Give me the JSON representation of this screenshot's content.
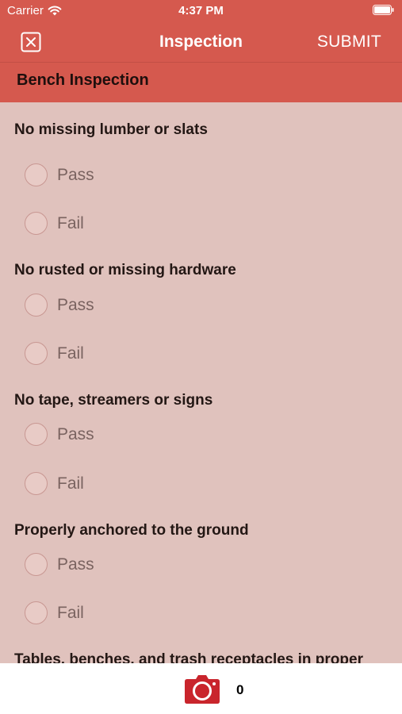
{
  "status_bar": {
    "carrier": "Carrier",
    "time": "4:37 PM",
    "wifi_icon": "wifi-icon",
    "battery_icon": "battery-icon"
  },
  "nav": {
    "close_icon": "close-icon",
    "title": "Inspection",
    "submit_label": "SUBMIT"
  },
  "section_title": "Bench Inspection",
  "questions": [
    {
      "label": "No missing lumber or slats",
      "options": [
        "Pass",
        "Fail"
      ]
    },
    {
      "label": "No rusted or missing hardware",
      "options": [
        "Pass",
        "Fail"
      ]
    },
    {
      "label": "No tape, streamers or signs",
      "options": [
        "Pass",
        "Fail"
      ]
    },
    {
      "label": "Properly anchored to the ground",
      "options": [
        "Pass",
        "Fail"
      ]
    },
    {
      "label": "Tables, benches, and trash receptacles in proper",
      "options": []
    }
  ],
  "bottom_bar": {
    "camera_icon": "camera-icon",
    "photo_count": "0"
  },
  "colors": {
    "header": "#d5594e",
    "background": "#e0c2bd",
    "camera": "#c9252c"
  }
}
